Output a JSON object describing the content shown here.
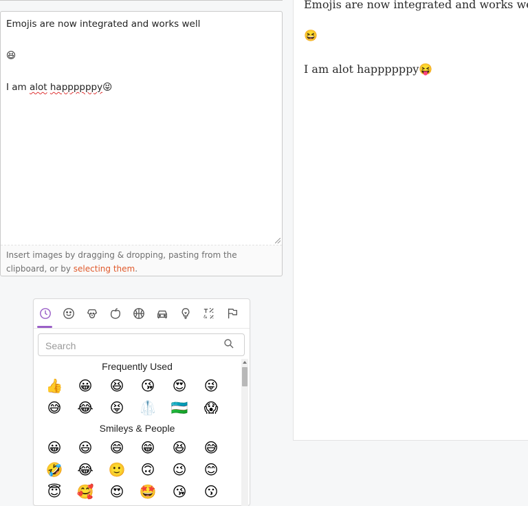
{
  "editor": {
    "lines": [
      "Emojis are now integrated and works well",
      "😆",
      "I am alot happppppy😝"
    ],
    "line3_prefix": "I am ",
    "line3_word1": "alot",
    "line3_space": " ",
    "line3_word2": "happppppy",
    "line3_emoji": "😝",
    "hint_text": "Insert images by dragging & dropping, pasting from the clipboard, or by ",
    "hint_link": "selecting them",
    "hint_end": "."
  },
  "preview": {
    "lines": [
      "Emojis are now integrated and works well",
      "😆",
      "I am alot happppppy😝"
    ]
  },
  "emoji_picker": {
    "categories": [
      "recent-icon",
      "smileys-icon",
      "animals-icon",
      "food-icon",
      "activity-icon",
      "travel-icon",
      "objects-icon",
      "symbols-icon",
      "flags-icon"
    ],
    "active_category": "recent-icon",
    "accent_color": "#9a5fc7",
    "search_placeholder": "Search",
    "sections": [
      {
        "title": "Frequently Used",
        "rows": [
          [
            "👍",
            "😀",
            "😆",
            "😘",
            "😍",
            "😜"
          ],
          [
            "😅",
            "😂",
            "😝",
            "🥼",
            "🇺🇿",
            "😱"
          ]
        ]
      },
      {
        "title": "Smileys & People",
        "rows": [
          [
            "😀",
            "😃",
            "😄",
            "😁",
            "😆",
            "😅"
          ],
          [
            "🤣",
            "😂",
            "🙂",
            "🙃",
            "😉",
            "😊"
          ],
          [
            "😇",
            "🥰",
            "😍",
            "🤩",
            "😘",
            "😗"
          ]
        ]
      }
    ]
  }
}
